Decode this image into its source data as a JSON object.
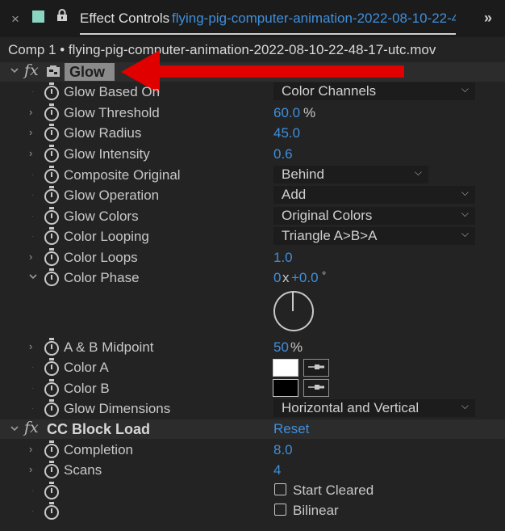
{
  "tab": {
    "close": "×",
    "title": "Effect Controls",
    "comp_name": "flying-pig-computer-animation-2022-08-10-22-4",
    "more": "»"
  },
  "breadcrumb": "Comp 1 • flying-pig-computer-animation-2022-08-10-22-48-17-utc.mov",
  "glow": {
    "fx": "fx",
    "title": "Glow",
    "properties": [
      {
        "label": "Glow Based On",
        "kind": "dropdown",
        "value": "Color Channels"
      },
      {
        "label": "Glow Threshold",
        "kind": "number",
        "value": "60.0",
        "unit": "%"
      },
      {
        "label": "Glow Radius",
        "kind": "number",
        "value": "45.0"
      },
      {
        "label": "Glow Intensity",
        "kind": "number",
        "value": "0.6"
      },
      {
        "label": "Composite Original",
        "kind": "dropdown",
        "value": "Behind"
      },
      {
        "label": "Glow Operation",
        "kind": "dropdown",
        "value": "Add"
      },
      {
        "label": "Glow Colors",
        "kind": "dropdown",
        "value": "Original Colors"
      },
      {
        "label": "Color Looping",
        "kind": "dropdown",
        "value": "Triangle A>B>A"
      },
      {
        "label": "Color Loops",
        "kind": "number",
        "value": "1.0"
      },
      {
        "label": "Color Phase",
        "kind": "angle",
        "revolutions": "0",
        "x": "x",
        "degrees": "+0.0",
        "deg_unit": "°"
      },
      {
        "label": "A & B Midpoint",
        "kind": "number",
        "value": "50",
        "unit": "%"
      },
      {
        "label": "Color A",
        "kind": "color",
        "value": "#ffffff"
      },
      {
        "label": "Color B",
        "kind": "color",
        "value": "#000000"
      },
      {
        "label": "Glow Dimensions",
        "kind": "dropdown",
        "value": "Horizontal and Vertical"
      }
    ]
  },
  "cc_block_load": {
    "fx": "fx",
    "title": "CC Block Load",
    "reset": "Reset",
    "properties": [
      {
        "label": "Completion",
        "value": "8.0"
      },
      {
        "label": "Scans",
        "value": "4"
      },
      {
        "label": "",
        "checkbox": "Start Cleared"
      },
      {
        "label": "",
        "checkbox": "Bilinear"
      }
    ]
  },
  "icons": {
    "twirl_open": "⌵",
    "twirl_closed": "›",
    "lock": "lock-icon",
    "stopwatch": "stopwatch-icon",
    "eyedropper": "eyedropper-icon"
  },
  "colors": {
    "accent_blue": "#3f8fdc",
    "background": "#232323",
    "annotation_arrow": "#e00000"
  }
}
